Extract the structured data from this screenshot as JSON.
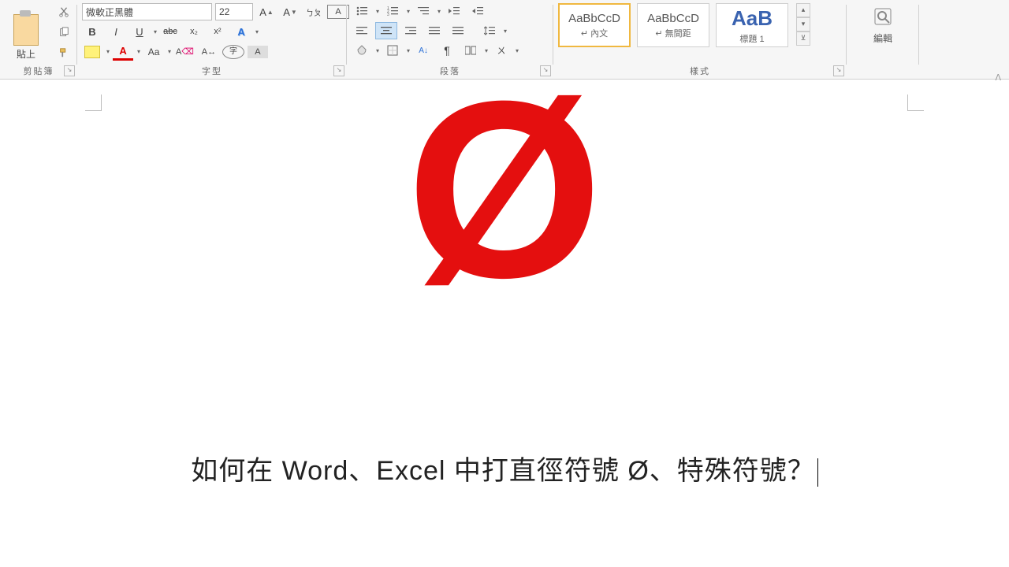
{
  "ribbon": {
    "clipboard": {
      "paste_label": "貼上",
      "group_label": "剪貼簿"
    },
    "font": {
      "name": "微軟正黑體",
      "size": "22",
      "group_label": "字型",
      "bold": "B",
      "italic": "I",
      "underline": "U",
      "strike": "abc",
      "sub": "x₂",
      "sup": "x²"
    },
    "paragraph": {
      "group_label": "段落"
    },
    "styles": {
      "group_label": "樣式",
      "items": [
        {
          "sample": "AaBbCcD",
          "name": "↵ 內文"
        },
        {
          "sample": "AaBbCcD",
          "name": "↵ 無間距"
        },
        {
          "sample": "AaB",
          "name": "標題 1"
        }
      ]
    },
    "editing": {
      "group_label": "編輯"
    }
  },
  "document": {
    "symbol": "Ø",
    "line": "如何在 Word、Excel 中打直徑符號 Ø、特殊符號？"
  }
}
